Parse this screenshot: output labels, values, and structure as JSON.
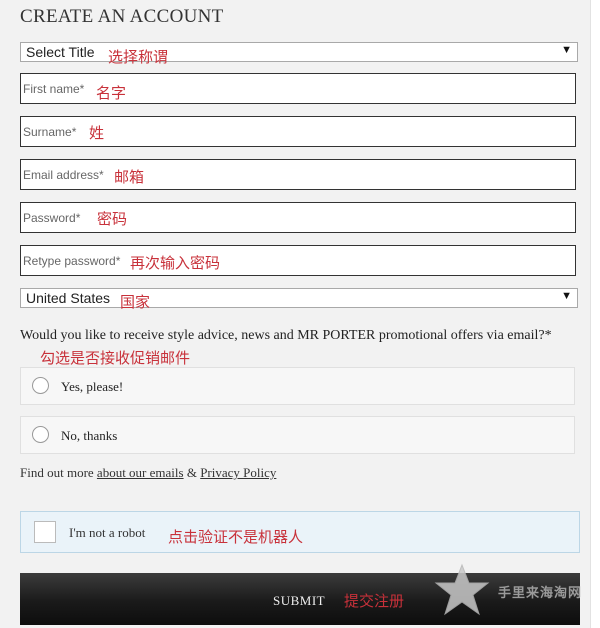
{
  "form": {
    "title": "CREATE AN ACCOUNT",
    "title_select": {
      "value": "Select Title",
      "note": "选择称谓"
    },
    "first_name": {
      "placeholder": "First name*",
      "note": "名字"
    },
    "surname": {
      "placeholder": "Surname*",
      "note": "姓"
    },
    "email": {
      "placeholder": "Email address*",
      "note": "邮箱"
    },
    "password": {
      "placeholder": "Password*",
      "note": "密码"
    },
    "retype_password": {
      "placeholder": "Retype password*",
      "note": "再次输入密码"
    },
    "country_select": {
      "value": "United States",
      "note": "国家"
    },
    "newsletter": {
      "question": "Would you like to receive style advice, news and MR PORTER promotional offers via email?*",
      "note": "勾选是否接收促销邮件",
      "options": [
        {
          "label": "Yes, please!"
        },
        {
          "label": "No, thanks"
        }
      ]
    },
    "links": {
      "prefix": "Find out more ",
      "emails_link": "about our emails",
      "amp": " & ",
      "privacy_link": "Privacy Policy"
    },
    "captcha": {
      "label": "I'm not a robot",
      "note": "点击验证不是机器人"
    },
    "submit": {
      "label": "SUBMIT",
      "note": "提交注册"
    }
  },
  "watermark": {
    "text": "手里来海淘网",
    "icon": "star-icon"
  },
  "colors": {
    "annotation": "#c8313a",
    "submit_bg": "#1a1a1a",
    "captcha_bg": "#eaf3f9"
  }
}
